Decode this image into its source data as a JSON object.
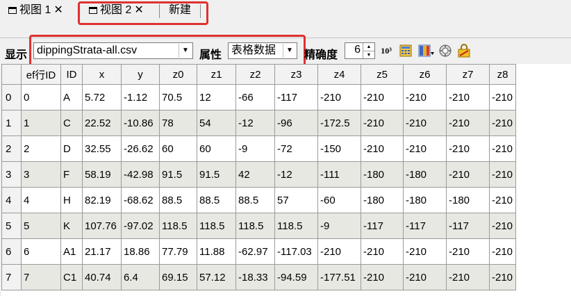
{
  "tabs": [
    {
      "title": "视图 1",
      "closable": true
    },
    {
      "title": "视图 2",
      "closable": true
    },
    {
      "title": "新建",
      "closable": false
    }
  ],
  "toolbar": {
    "display_label": "显示",
    "file_value": "dippingStrata-all.csv",
    "attribute_label": "属性",
    "attribute_value": "表格数据",
    "precision_label": "精确度",
    "precision_value": "6",
    "sci_notation_label": "10³"
  },
  "table": {
    "columns": [
      "ef行ID",
      "ID",
      "x",
      "y",
      "z0",
      "z1",
      "z2",
      "z3",
      "z4",
      "z5",
      "z6",
      "z7",
      "z8"
    ],
    "row_headers": [
      "0",
      "1",
      "2",
      "3",
      "4",
      "5",
      "6",
      "7"
    ],
    "rows": [
      [
        "0",
        "A",
        "5.72",
        "-1.12",
        "70.5",
        "12",
        "-66",
        "-117",
        "-210",
        "-210",
        "-210",
        "-210",
        "-210"
      ],
      [
        "1",
        "C",
        "22.52",
        "-10.86",
        "78",
        "54",
        "-12",
        "-96",
        "-172.5",
        "-210",
        "-210",
        "-210",
        "-210"
      ],
      [
        "2",
        "D",
        "32.55",
        "-26.62",
        "60",
        "60",
        "-9",
        "-72",
        "-150",
        "-210",
        "-210",
        "-210",
        "-210"
      ],
      [
        "3",
        "F",
        "58.19",
        "-42.98",
        "91.5",
        "91.5",
        "42",
        "-12",
        "-111",
        "-180",
        "-180",
        "-210",
        "-210"
      ],
      [
        "4",
        "H",
        "82.19",
        "-68.62",
        "88.5",
        "88.5",
        "88.5",
        "57",
        "-60",
        "-180",
        "-180",
        "-180",
        "-210"
      ],
      [
        "5",
        "K",
        "107.76",
        "-97.02",
        "118.5",
        "118.5",
        "118.5",
        "118.5",
        "-9",
        "-117",
        "-117",
        "-117",
        "-210"
      ],
      [
        "6",
        "A1",
        "21.17",
        "18.86",
        "77.79",
        "11.88",
        "-62.97",
        "-117.03",
        "-210",
        "-210",
        "-210",
        "-210",
        "-210"
      ],
      [
        "7",
        "C1",
        "40.74",
        "6.4",
        "69.15",
        "57.12",
        "-18.33",
        "-94.59",
        "-177.51",
        "-210",
        "-210",
        "-210",
        "-210"
      ]
    ]
  },
  "colors": {
    "highlight": "#e03030",
    "alt_row": "#e8e8e3"
  }
}
